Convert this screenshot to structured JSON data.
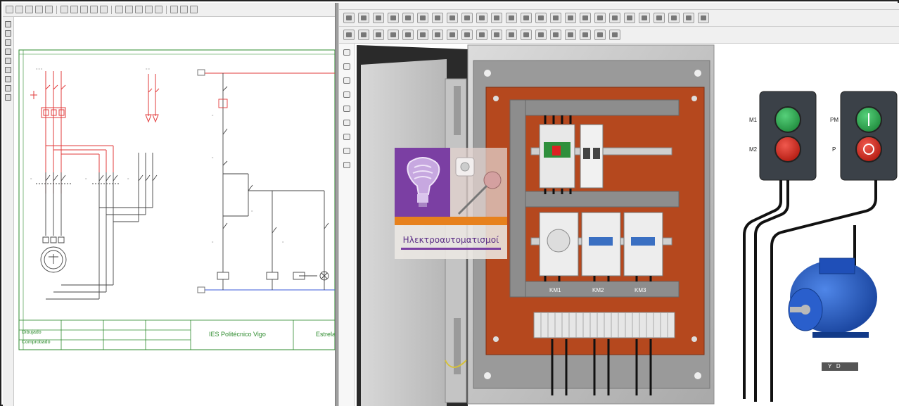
{
  "left_window": {
    "toolbar_buttons": 22,
    "tools": [
      "pointer-icon",
      "line-icon",
      "rectangle-icon",
      "circle-icon",
      "polygon-icon",
      "ellipse-icon",
      "fill-icon",
      "pen-icon",
      "text-icon"
    ],
    "title_block": {
      "row1_labels": [
        "Dibujado",
        "Comprobado"
      ],
      "school": "IES Politécnico Vigo",
      "drawing_title": "Estrela",
      "accent_color": "#2e8b2e"
    },
    "colors": {
      "power_circuit": "#e23b3b",
      "control_circuit": "#333333",
      "supply_bus": "#3a5ad8",
      "frame": "#2e8b2e"
    }
  },
  "right_window": {
    "logo_caption": "Ηλεκτροαυτοματισμοί",
    "push_buttons_left": {
      "top_label": "M1",
      "bottom_label": "M2"
    },
    "push_buttons_right": {
      "top_label": "PM",
      "bottom_label": "P"
    },
    "contactors": [
      "KM1",
      "KM2",
      "KM3"
    ],
    "motor_label": "Y   D",
    "colors": {
      "panel_plate": "#b5481e",
      "cabinet": "#cfcfcf",
      "button_green": "#2fa84f",
      "button_red": "#d4271c",
      "motor_blue": "#1f4fb8"
    }
  }
}
